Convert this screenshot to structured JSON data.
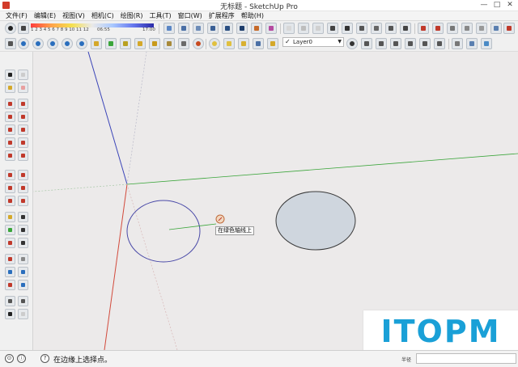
{
  "window": {
    "title": "无标题 - SketchUp Pro",
    "minimize": "—",
    "maximize": "□",
    "close": "✕"
  },
  "menu": [
    "文件(F)",
    "编辑(E)",
    "视图(V)",
    "相机(C)",
    "绘图(R)",
    "工具(T)",
    "窗口(W)",
    "扩展程序",
    "帮助(H)"
  ],
  "toolbar": {
    "shadow_time_numbers": "1 2 3 4 5 6 7 8 9 10 11 12",
    "shadow_time_start": "06:55",
    "shadow_time_mid": "中午",
    "shadow_time_end": "17:00",
    "layer_check": "✓",
    "layer_name": "Layer0",
    "layer_chevron": "▼"
  },
  "canvas": {
    "tooltip": "在绿色轴线上",
    "axis_colors": {
      "red": "#d24a3c",
      "green": "#3aa53a",
      "blue": "#3a44b8"
    },
    "circle_fill": "#cfd6de",
    "circle_stroke": "#3a3a3a"
  },
  "watermark": "ITOPM",
  "status": {
    "icon1": "⊙",
    "icon2": "ⓘ",
    "icon3": "?",
    "text": "在边缘上选择点。",
    "measure_label": "半径"
  }
}
